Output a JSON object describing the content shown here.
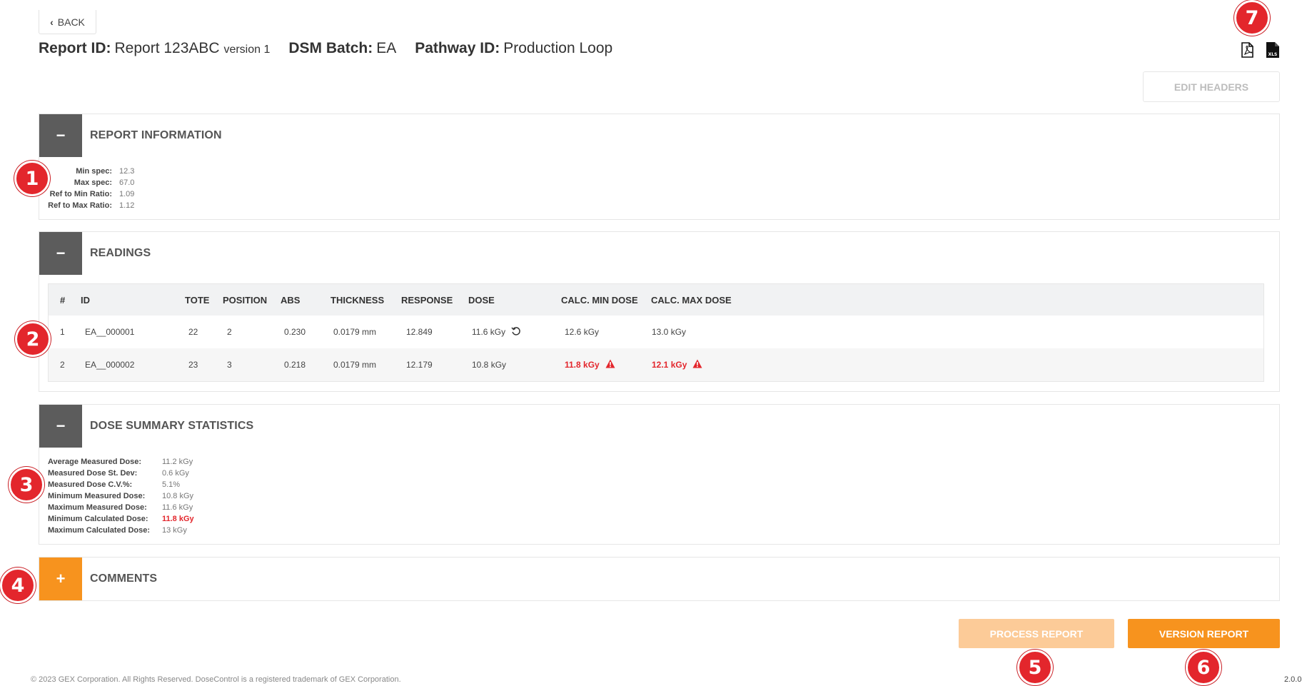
{
  "nav": {
    "back_label": "BACK"
  },
  "header": {
    "report_id_label": "Report ID:",
    "report_id_value": "Report 123ABC",
    "report_version": "version 1",
    "batch_label": "DSM Batch:",
    "batch_value": "EA",
    "pathway_label": "Pathway ID:",
    "pathway_value": "Production Loop",
    "export_icons": [
      "pdf-export-icon",
      "xls-export-icon"
    ],
    "xls_icon_text": "XLS",
    "edit_headers_label": "EDIT HEADERS"
  },
  "report_info": {
    "title": "REPORT INFORMATION",
    "toggle": "−",
    "rows": [
      {
        "label": "Min spec:",
        "value": "12.3"
      },
      {
        "label": "Max spec:",
        "value": "67.0"
      },
      {
        "label": "Ref to Min Ratio:",
        "value": "1.09"
      },
      {
        "label": "Ref to Max Ratio:",
        "value": "1.12"
      }
    ]
  },
  "readings": {
    "title": "READINGS",
    "toggle": "−",
    "columns": [
      "#",
      "ID",
      "TOTE",
      "POSITION",
      "ABS",
      "THICKNESS",
      "RESPONSE",
      "DOSE",
      "CALC. MIN DOSE",
      "CALC. MAX DOSE"
    ],
    "rows": [
      {
        "num": "1",
        "id": "EA__000001",
        "tote": "22",
        "position": "2",
        "abs": "0.230",
        "thickness": "0.0179 mm",
        "response": "12.849",
        "dose": "11.6 kGy",
        "calc_min": "12.6 kGy",
        "calc_max": "13.0 kGy"
      },
      {
        "num": "2",
        "id": "EA__000002",
        "tote": "23",
        "position": "3",
        "abs": "0.218",
        "thickness": "0.0179 mm",
        "response": "12.179",
        "dose": "10.8 kGy",
        "calc_min": "11.8 kGy",
        "calc_max": "12.1 kGy"
      }
    ]
  },
  "dose_summary": {
    "title": "DOSE SUMMARY STATISTICS",
    "toggle": "−",
    "rows": [
      {
        "label": "Average Measured Dose:",
        "value": "11.2 kGy"
      },
      {
        "label": "Measured Dose St. Dev:",
        "value": "0.6 kGy"
      },
      {
        "label": "Measured Dose C.V.%:",
        "value": "5.1%"
      },
      {
        "label": "Minimum Measured Dose:",
        "value": "10.8 kGy"
      },
      {
        "label": "Maximum Measured Dose:",
        "value": "11.6 kGy"
      },
      {
        "label": "Minimum Calculated Dose:",
        "value": "11.8 kGy"
      },
      {
        "label": "Maximum Calculated Dose:",
        "value": "13 kGy"
      }
    ]
  },
  "comments": {
    "title": "COMMENTS",
    "toggle": "+"
  },
  "actions": {
    "process_label": "PROCESS REPORT",
    "version_label": "VERSION REPORT"
  },
  "footer": {
    "copyright": "© 2023 GEX Corporation. All Rights Reserved. DoseControl is a registered trademark of GEX Corporation.",
    "version": "2.0.0"
  },
  "annotations": [
    "1",
    "2",
    "3",
    "4",
    "5",
    "6",
    "7"
  ],
  "colors": {
    "accent": "#f7931e",
    "accent_disabled": "#fccb98",
    "alert": "#e3262c",
    "toggle_dark": "#5c5c5c"
  }
}
